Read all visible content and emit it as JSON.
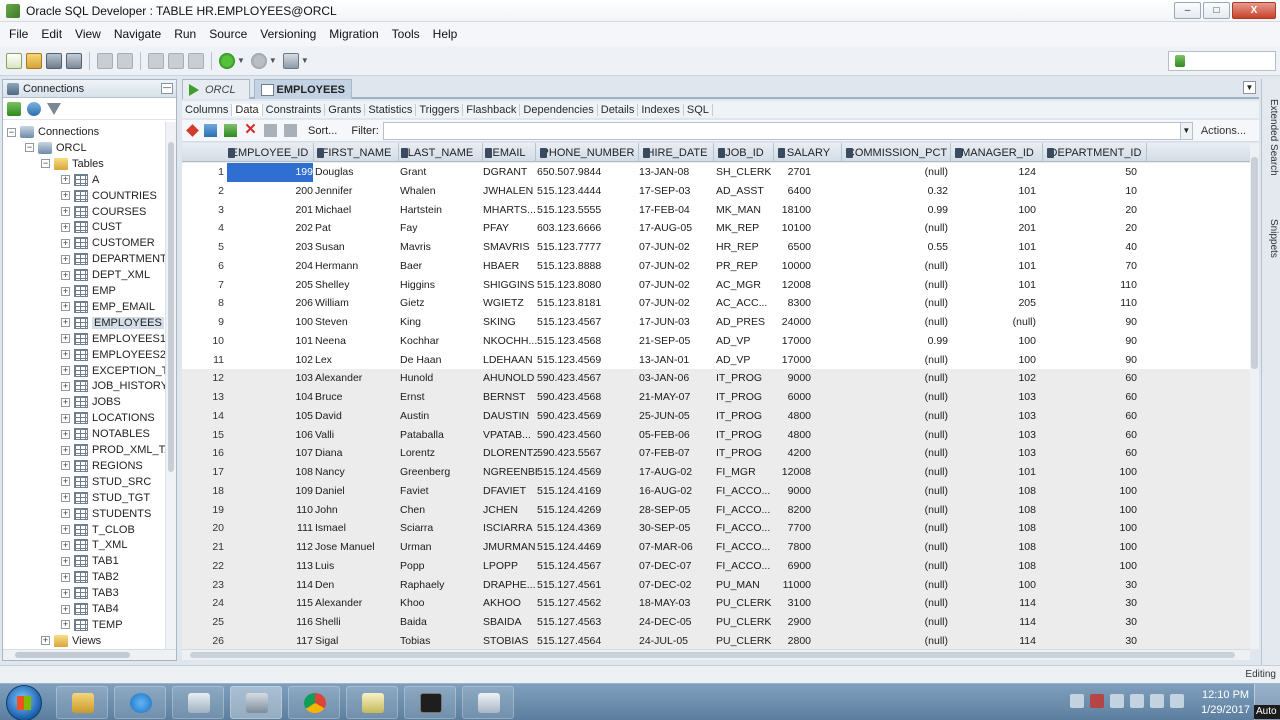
{
  "window": {
    "title": "Oracle SQL Developer : TABLE HR.EMPLOYEES@ORCL",
    "buttons": {
      "minimize": "–",
      "maximize": "□",
      "close": "X"
    }
  },
  "menu": [
    "File",
    "Edit",
    "View",
    "Navigate",
    "Run",
    "Source",
    "Versioning",
    "Migration",
    "Tools",
    "Help"
  ],
  "connections_panel": {
    "title": "Connections",
    "tree": {
      "root": "Connections",
      "connection": "ORCL",
      "tables_folder": "Tables",
      "tables": [
        "A",
        "COUNTRIES",
        "COURSES",
        "CUST",
        "CUSTOMER",
        "DEPARTMENTS",
        "DEPT_XML",
        "EMP",
        "EMP_EMAIL",
        "EMPLOYEES",
        "EMPLOYEES1",
        "EMPLOYEES2",
        "EXCEPTION_TE",
        "JOB_HISTORY",
        "JOBS",
        "LOCATIONS",
        "NOTABLES",
        "PROD_XML_TA",
        "REGIONS",
        "STUD_SRC",
        "STUD_TGT",
        "STUDENTS",
        "T_CLOB",
        "T_XML",
        "TAB1",
        "TAB2",
        "TAB3",
        "TAB4",
        "TEMP"
      ],
      "selected_table": "EMPLOYEES",
      "views_folder": "Views"
    }
  },
  "doc_tabs": [
    {
      "label": "ORCL",
      "active": false
    },
    {
      "label": "EMPLOYEES",
      "active": true
    }
  ],
  "sub_tabs": [
    "Columns",
    "Data",
    "Constraints",
    "Grants",
    "Statistics",
    "Triggers",
    "Flashback",
    "Dependencies",
    "Details",
    "Indexes",
    "SQL"
  ],
  "active_sub_tab": "Data",
  "data_toolbar": {
    "sort_label": "Sort...",
    "filter_label": "Filter:",
    "filter_value": "",
    "actions_label": "Actions..."
  },
  "grid": {
    "columns": [
      "EMPLOYEE_ID",
      "FIRST_NAME",
      "LAST_NAME",
      "EMAIL",
      "PHONE_NUMBER",
      "HIRE_DATE",
      "JOB_ID",
      "SALARY",
      "COMMISSION_PCT",
      "MANAGER_ID",
      "DEPARTMENT_ID"
    ],
    "rows": [
      [
        "1",
        "199",
        "Douglas",
        "Grant",
        "DGRANT",
        "650.507.9844",
        "13-JAN-08",
        "SH_CLERK",
        "2701",
        "(null)",
        "124",
        "50"
      ],
      [
        "2",
        "200",
        "Jennifer",
        "Whalen",
        "JWHALEN",
        "515.123.4444",
        "17-SEP-03",
        "AD_ASST",
        "6400",
        "0.32",
        "101",
        "10"
      ],
      [
        "3",
        "201",
        "Michael",
        "Hartstein",
        "MHARTS...",
        "515.123.5555",
        "17-FEB-04",
        "MK_MAN",
        "18100",
        "0.99",
        "100",
        "20"
      ],
      [
        "4",
        "202",
        "Pat",
        "Fay",
        "PFAY",
        "603.123.6666",
        "17-AUG-05",
        "MK_REP",
        "10100",
        "(null)",
        "201",
        "20"
      ],
      [
        "5",
        "203",
        "Susan",
        "Mavris",
        "SMAVRIS",
        "515.123.7777",
        "07-JUN-02",
        "HR_REP",
        "6500",
        "0.55",
        "101",
        "40"
      ],
      [
        "6",
        "204",
        "Hermann",
        "Baer",
        "HBAER",
        "515.123.8888",
        "07-JUN-02",
        "PR_REP",
        "10000",
        "(null)",
        "101",
        "70"
      ],
      [
        "7",
        "205",
        "Shelley",
        "Higgins",
        "SHIGGINS",
        "515.123.8080",
        "07-JUN-02",
        "AC_MGR",
        "12008",
        "(null)",
        "101",
        "110"
      ],
      [
        "8",
        "206",
        "William",
        "Gietz",
        "WGIETZ",
        "515.123.8181",
        "07-JUN-02",
        "AC_ACC...",
        "8300",
        "(null)",
        "205",
        "110"
      ],
      [
        "9",
        "100",
        "Steven",
        "King",
        "SKING",
        "515.123.4567",
        "17-JUN-03",
        "AD_PRES",
        "24000",
        "(null)",
        "(null)",
        "90"
      ],
      [
        "10",
        "101",
        "Neena",
        "Kochhar",
        "NKOCHH...",
        "515.123.4568",
        "21-SEP-05",
        "AD_VP",
        "17000",
        "0.99",
        "100",
        "90"
      ],
      [
        "11",
        "102",
        "Lex",
        "De Haan",
        "LDEHAAN",
        "515.123.4569",
        "13-JAN-01",
        "AD_VP",
        "17000",
        "(null)",
        "100",
        "90"
      ],
      [
        "12",
        "103",
        "Alexander",
        "Hunold",
        "AHUNOLD",
        "590.423.4567",
        "03-JAN-06",
        "IT_PROG",
        "9000",
        "(null)",
        "102",
        "60"
      ],
      [
        "13",
        "104",
        "Bruce",
        "Ernst",
        "BERNST",
        "590.423.4568",
        "21-MAY-07",
        "IT_PROG",
        "6000",
        "(null)",
        "103",
        "60"
      ],
      [
        "14",
        "105",
        "David",
        "Austin",
        "DAUSTIN",
        "590.423.4569",
        "25-JUN-05",
        "IT_PROG",
        "4800",
        "(null)",
        "103",
        "60"
      ],
      [
        "15",
        "106",
        "Valli",
        "Pataballa",
        "VPATAB...",
        "590.423.4560",
        "05-FEB-06",
        "IT_PROG",
        "4800",
        "(null)",
        "103",
        "60"
      ],
      [
        "16",
        "107",
        "Diana",
        "Lorentz",
        "DLORENTZ",
        "590.423.5567",
        "07-FEB-07",
        "IT_PROG",
        "4200",
        "(null)",
        "103",
        "60"
      ],
      [
        "17",
        "108",
        "Nancy",
        "Greenberg",
        "NGREENBE",
        "515.124.4569",
        "17-AUG-02",
        "FI_MGR",
        "12008",
        "(null)",
        "101",
        "100"
      ],
      [
        "18",
        "109",
        "Daniel",
        "Faviet",
        "DFAVIET",
        "515.124.4169",
        "16-AUG-02",
        "FI_ACCO...",
        "9000",
        "(null)",
        "108",
        "100"
      ],
      [
        "19",
        "110",
        "John",
        "Chen",
        "JCHEN",
        "515.124.4269",
        "28-SEP-05",
        "FI_ACCO...",
        "8200",
        "(null)",
        "108",
        "100"
      ],
      [
        "20",
        "111",
        "Ismael",
        "Sciarra",
        "ISCIARRA",
        "515.124.4369",
        "30-SEP-05",
        "FI_ACCO...",
        "7700",
        "(null)",
        "108",
        "100"
      ],
      [
        "21",
        "112",
        "Jose Manuel",
        "Urman",
        "JMURMAN",
        "515.124.4469",
        "07-MAR-06",
        "FI_ACCO...",
        "7800",
        "(null)",
        "108",
        "100"
      ],
      [
        "22",
        "113",
        "Luis",
        "Popp",
        "LPOPP",
        "515.124.4567",
        "07-DEC-07",
        "FI_ACCO...",
        "6900",
        "(null)",
        "108",
        "100"
      ],
      [
        "23",
        "114",
        "Den",
        "Raphaely",
        "DRAPHE...",
        "515.127.4561",
        "07-DEC-02",
        "PU_MAN",
        "11000",
        "(null)",
        "100",
        "30"
      ],
      [
        "24",
        "115",
        "Alexander",
        "Khoo",
        "AKHOO",
        "515.127.4562",
        "18-MAY-03",
        "PU_CLERK",
        "3100",
        "(null)",
        "114",
        "30"
      ],
      [
        "25",
        "116",
        "Shelli",
        "Baida",
        "SBAIDA",
        "515.127.4563",
        "24-DEC-05",
        "PU_CLERK",
        "2900",
        "(null)",
        "114",
        "30"
      ],
      [
        "26",
        "117",
        "Sigal",
        "Tobias",
        "STOBIAS",
        "515.127.4564",
        "24-JUL-05",
        "PU_CLERK",
        "2800",
        "(null)",
        "114",
        "30"
      ]
    ],
    "selected_row": 1
  },
  "right_sidebar": [
    "Extended Search",
    "Snippets"
  ],
  "status": {
    "mode": "Editing"
  },
  "taskbar": {
    "time": "12:10 PM",
    "date": "1/29/2017",
    "corner": "Auto"
  },
  "colors": {
    "selection": "#2f6fd1",
    "tab_active": "#c3d3e4"
  }
}
